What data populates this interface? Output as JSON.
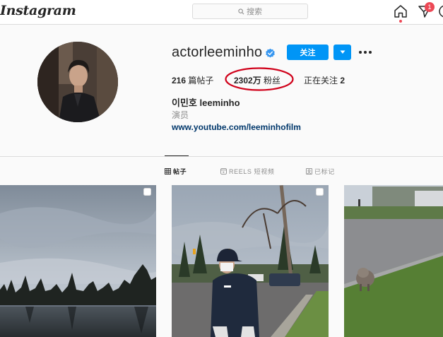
{
  "header": {
    "logo": "Instagram",
    "search_placeholder": "搜索",
    "notification_count": "1"
  },
  "profile": {
    "username": "actorleeminho",
    "follow_label": "关注",
    "posts_count": "216",
    "posts_label": " 篇帖子",
    "followers_count": "2302万",
    "followers_label": " 粉丝",
    "following_label": "正在关注 ",
    "following_count": "2",
    "full_name": "이민호 leeminho",
    "category": "演员",
    "website": "www.youtube.com/leeminhofilm"
  },
  "tabs": [
    {
      "label": "帖子",
      "icon": "grid-icon",
      "active": true
    },
    {
      "label": "REELS 短视频",
      "icon": "reels-icon",
      "active": false
    },
    {
      "label": "已标记",
      "icon": "tagged-icon",
      "active": false
    }
  ],
  "colors": {
    "accent": "#0095f6",
    "badge": "#ed4956",
    "annotation": "#d0021b",
    "link": "#00376b"
  }
}
